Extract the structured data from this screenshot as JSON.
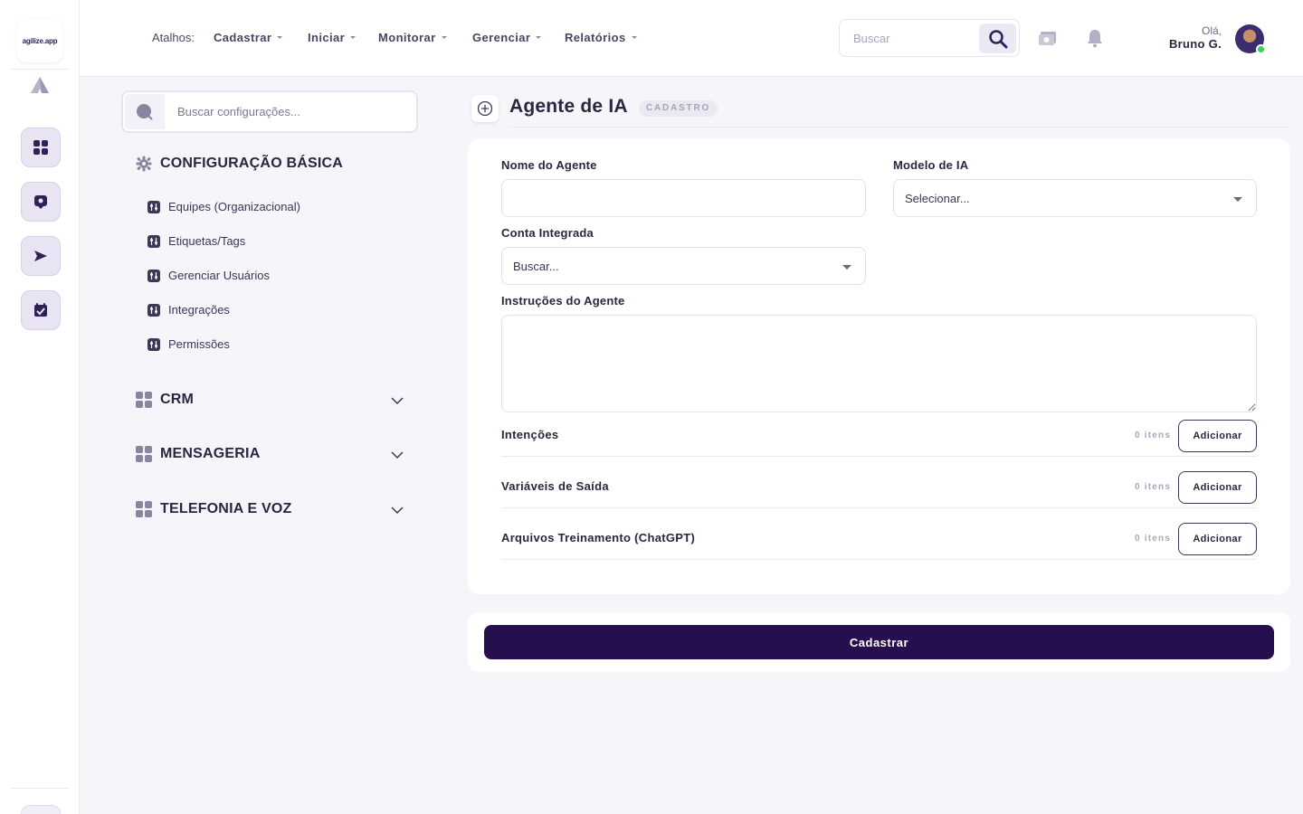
{
  "brand": {
    "logo_text": "agilize.app"
  },
  "topbar": {
    "shortcut_label": "Atalhos:",
    "menus": [
      "Cadastrar",
      "Iniciar",
      "Monitorar",
      "Gerenciar",
      "Relatórios"
    ],
    "search_placeholder": "Buscar",
    "greeting": "Olá,",
    "user_name": "Bruno G."
  },
  "settings": {
    "search_placeholder": "Buscar configurações...",
    "sections": [
      {
        "title": "CONFIGURAÇÃO BÁSICA",
        "items": [
          "Equipes (Organizacional)",
          "Etiquetas/Tags",
          "Gerenciar Usuários",
          "Integrações",
          "Permissões"
        ]
      },
      {
        "title": "CRM"
      },
      {
        "title": "MENSAGERIA"
      },
      {
        "title": "TELEFONIA E VOZ"
      }
    ]
  },
  "page": {
    "title": "Agente de IA",
    "badge": "CADASTRO"
  },
  "form": {
    "agent_name_label": "Nome do Agente",
    "agent_name_value": "",
    "model_label": "Modelo de IA",
    "model_value": "Selecionar...",
    "account_label": "Conta Integrada",
    "account_value": "Buscar...",
    "instructions_label": "Instruções do Agente",
    "instructions_value": "",
    "lists": [
      {
        "title": "Intenções",
        "count": "0 itens",
        "button": "Adicionar"
      },
      {
        "title": "Variáveis de Saída",
        "count": "0 itens",
        "button": "Adicionar"
      },
      {
        "title": "Arquivos Treinamento (ChatGPT)",
        "count": "0 itens",
        "button": "Adicionar"
      }
    ],
    "submit_label": "Cadastrar"
  },
  "colors": {
    "primary": "#270e4f",
    "accent_light": "#e9e4f3",
    "online": "#3ccf5c"
  }
}
